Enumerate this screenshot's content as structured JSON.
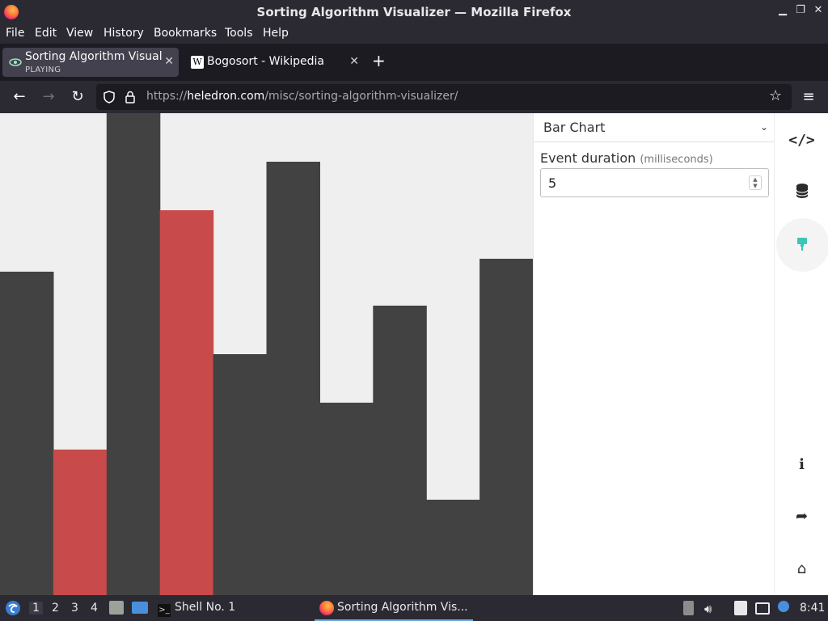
{
  "window": {
    "title": "Sorting Algorithm Visualizer — Mozilla Firefox",
    "controls": [
      "minimize-icon",
      "restore-icon",
      "close-icon"
    ]
  },
  "menu": [
    "File",
    "Edit",
    "View",
    "History",
    "Bookmarks",
    "Tools",
    "Help"
  ],
  "tabs": [
    {
      "title": "Sorting Algorithm Visualizer",
      "status": "PLAYING",
      "icon": "eye-icon",
      "active": true
    },
    {
      "title": "Bogosort - Wikipedia",
      "icon": "wikipedia-icon",
      "active": false
    }
  ],
  "url": {
    "scheme": "https://",
    "host": "heledron.com",
    "path": "/misc/sorting-algorithm-visualizer/"
  },
  "chart_data": {
    "type": "bar",
    "categories": [
      1,
      2,
      3,
      4,
      5,
      6,
      7,
      8,
      9,
      10
    ],
    "values": [
      400,
      180,
      596,
      476,
      298,
      536,
      238,
      358,
      118,
      416
    ],
    "highlighted": [
      2,
      4
    ],
    "ylim": [
      0,
      596
    ],
    "colors": {
      "bar": "#424242",
      "highlight": "#c84a4a",
      "background": "#efefef"
    }
  },
  "panel": {
    "view_select": "Bar Chart",
    "duration_label": "Event duration",
    "duration_unit": "(milliseconds)",
    "duration_value": "5"
  },
  "rail": [
    "code-icon",
    "database-icon",
    "paint-brush-icon",
    "info-icon",
    "share-icon",
    "home-icon"
  ],
  "taskbar": {
    "workspaces": [
      "1",
      "2",
      "3",
      "4"
    ],
    "active_workspace": "1",
    "terminal": "Shell No. 1",
    "firefox": "Sorting Algorithm Vis...",
    "clock": "8:41"
  }
}
